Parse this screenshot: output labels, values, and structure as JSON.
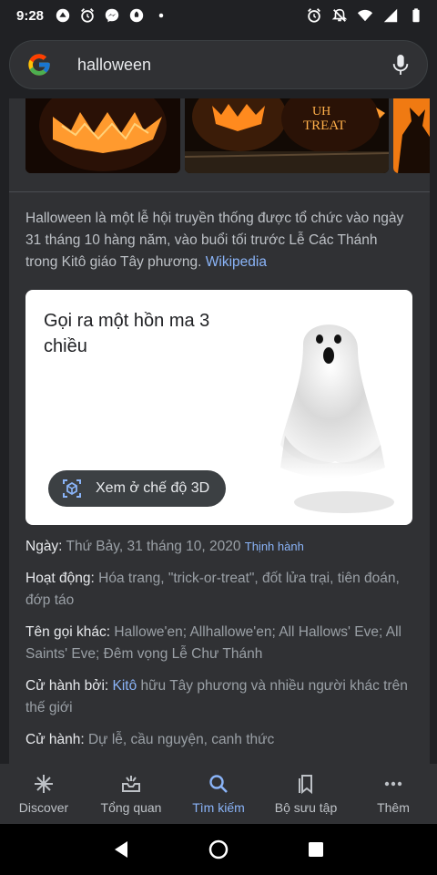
{
  "status_bar": {
    "time": "9:28"
  },
  "search": {
    "query": "halloween"
  },
  "description": {
    "text": "Halloween là một lễ hội truyền thống được tổ chức vào ngày 31 tháng 10 hàng năm, vào buổi tối trước Lễ Các Thánh trong Kitô giáo Tây phương.",
    "source": "Wikipedia"
  },
  "ghost_card": {
    "title": "Gọi ra một hồn ma 3 chiều",
    "button_label": "Xem ở chế độ 3D"
  },
  "facts": [
    {
      "key": "Ngày:",
      "value": "Thứ Bảy, 31 tháng 10, 2020",
      "extra": "Thịnh hành"
    },
    {
      "key": "Hoạt động:",
      "value": "Hóa trang, \"trick-or-treat\", đốt lửa trại, tiên đoán, đớp táo"
    },
    {
      "key": "Tên gọi khác:",
      "value": "Hallowe'en; Allhallowe'en; All Hallows' Eve; All Saints' Eve; Đêm vọng Lễ Chư Thánh"
    },
    {
      "key": "Cử hành bởi:",
      "link": "Kitô",
      "value": "hữu Tây phương và nhiều người khác trên thế giới"
    },
    {
      "key": "Cử hành:",
      "value": "Dự lễ, cầu nguyện, canh thức"
    }
  ],
  "bottom_nav": {
    "items": [
      {
        "label": "Discover",
        "icon": "asterisk-icon"
      },
      {
        "label": "Tổng quan",
        "icon": "inbox-icon"
      },
      {
        "label": "Tìm kiếm",
        "icon": "search-icon",
        "active": true
      },
      {
        "label": "Bộ sưu tập",
        "icon": "collections-icon"
      },
      {
        "label": "Thêm",
        "icon": "more-icon"
      }
    ]
  },
  "colors": {
    "accent": "#8ab4f8",
    "background": "#202124",
    "card": "#303134"
  }
}
